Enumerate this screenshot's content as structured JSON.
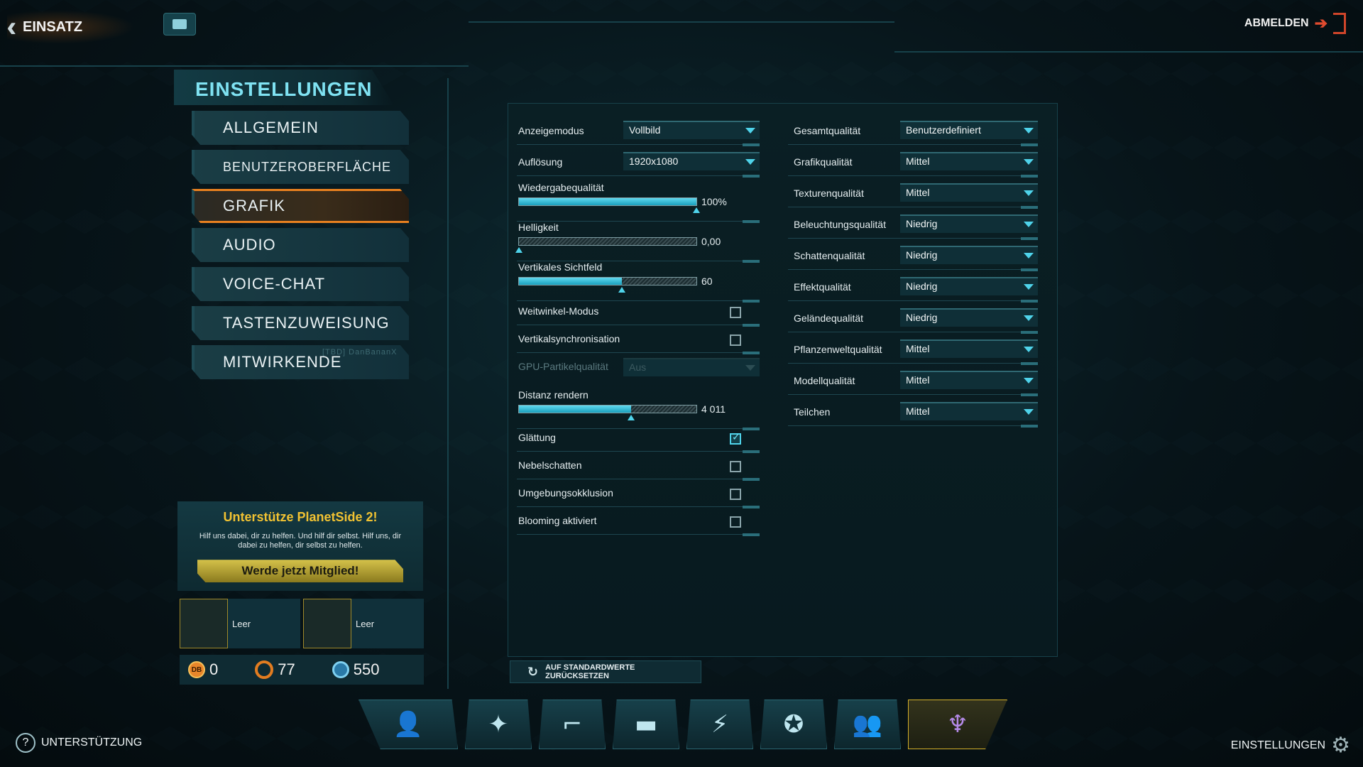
{
  "topbar": {
    "back_label": "EINSATZ",
    "logout_label": "ABMELDEN"
  },
  "nav": {
    "title": "EINSTELLUNGEN",
    "items": [
      {
        "label": "ALLGEMEIN"
      },
      {
        "label": "BENUTZEROBERFLÄCHE"
      },
      {
        "label": "GRAFIK"
      },
      {
        "label": "AUDIO"
      },
      {
        "label": "VOICE-CHAT"
      },
      {
        "label": "TASTENZUWEISUNG"
      },
      {
        "label": "MITWIRKENDE"
      }
    ],
    "active": "GRAFIK",
    "ghost_text": "[TBD] DanBananX"
  },
  "promo": {
    "title": "Unterstütze PlanetSide 2!",
    "text": "Hilf uns dabei, dir zu helfen. Und hilf dir selbst. Hilf uns, dir dabei zu helfen, dir selbst zu helfen.",
    "button": "Werde jetzt Mitglied!"
  },
  "slots": [
    {
      "label": "Leer"
    },
    {
      "label": "Leer"
    }
  ],
  "currency": {
    "db_icon": "DB",
    "db": "0",
    "certs": "77",
    "ac": "550"
  },
  "left_column": {
    "display_mode": {
      "label": "Anzeigemodus",
      "value": "Vollbild"
    },
    "resolution": {
      "label": "Auflösung",
      "value": "1920x1080"
    },
    "render_quality": {
      "label": "Wiedergabequalität",
      "value": "100%",
      "level": 1.0
    },
    "brightness": {
      "label": "Helligkeit",
      "value": "0,00",
      "level": 0.0
    },
    "fov": {
      "label": "Vertikales Sichtfeld",
      "value": "60",
      "level": 0.58
    },
    "wide_angle": {
      "label": "Weitwinkel-Modus",
      "checked": false
    },
    "vsync": {
      "label": "Vertikalsynchronisation",
      "checked": false
    },
    "gpu_particles": {
      "label": "GPU-Partikelqualität",
      "value": "Aus",
      "disabled": true
    },
    "render_distance": {
      "label": "Distanz rendern",
      "value": "4 011",
      "level": 0.63
    },
    "smoothing": {
      "label": "Glättung",
      "checked": true
    },
    "fog_shadows": {
      "label": "Nebelschatten",
      "checked": false
    },
    "ambient_occlusion": {
      "label": "Umgebungsokklusion",
      "checked": false
    },
    "bloom": {
      "label": "Blooming aktiviert",
      "checked": false
    }
  },
  "right_column": [
    {
      "label": "Gesamtqualität",
      "value": "Benutzerdefiniert"
    },
    {
      "label": "Grafikqualität",
      "value": "Mittel"
    },
    {
      "label": "Texturenqualität",
      "value": "Mittel"
    },
    {
      "label": "Beleuchtungsqualität",
      "value": "Niedrig"
    },
    {
      "label": "Schattenqualität",
      "value": "Niedrig"
    },
    {
      "label": "Effektqualität",
      "value": "Niedrig"
    },
    {
      "label": "Geländequalität",
      "value": "Niedrig"
    },
    {
      "label": "Pflanzenweltqualität",
      "value": "Mittel"
    },
    {
      "label": "Modellqualität",
      "value": "Mittel"
    },
    {
      "label": "Teilchen",
      "value": "Mittel"
    }
  ],
  "reset_label": "AUF STANDARDWERTE ZURÜCKSETZEN",
  "bottom": {
    "support_label": "UNTERSTÜTZUNG",
    "settings_label": "EINSTELLUNGEN",
    "tabs": [
      {
        "icon": "soldier-icon"
      },
      {
        "icon": "compass-map-icon"
      },
      {
        "icon": "weapon-icon"
      },
      {
        "icon": "vehicle-tank-icon"
      },
      {
        "icon": "implant-energy-icon"
      },
      {
        "icon": "achievement-star-icon"
      },
      {
        "icon": "social-friends-icon"
      },
      {
        "icon": "faction-vanu-icon"
      }
    ]
  },
  "colors": {
    "accent": "#4fd3ea",
    "active_tab": "#e8801f",
    "promo_title": "#f1c232"
  }
}
